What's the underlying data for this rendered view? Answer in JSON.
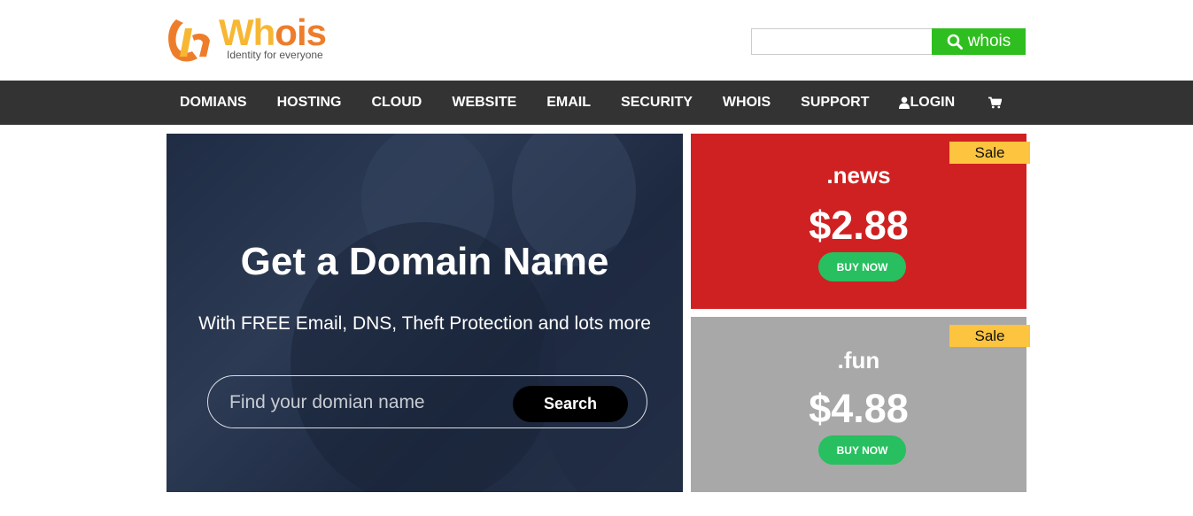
{
  "brand": {
    "name_part1": "Wh",
    "name_part2": "o",
    "name_part3": "is",
    "tagline": "Identity for everyone",
    "colors": {
      "yellow": "#f7b733",
      "orange": "#ee7d2b"
    }
  },
  "top_search": {
    "value": "",
    "button_label": "whois",
    "button_color": "#2fbe1f"
  },
  "nav": {
    "items": [
      "DOMIANS",
      "HOSTING",
      "CLOUD",
      "WEBSITE",
      "EMAIL",
      "SECURITY",
      "WHOIS",
      "SUPPORT"
    ],
    "login_label": "LOGIN",
    "cart_icon": "cart-icon"
  },
  "hero": {
    "title": "Get a Domain Name",
    "subtitle": "With FREE Email, DNS, Theft Protection and lots more",
    "search_placeholder": "Find your domian name",
    "search_button": "Search"
  },
  "promos": [
    {
      "badge": "Sale",
      "tld": ".news",
      "price": "$2.88",
      "button": "BUY NOW",
      "bg": "#d02122"
    },
    {
      "badge": "Sale",
      "tld": ".fun",
      "price": "$4.88",
      "button": "BUY NOW",
      "bg": "#a8a8a8"
    }
  ]
}
